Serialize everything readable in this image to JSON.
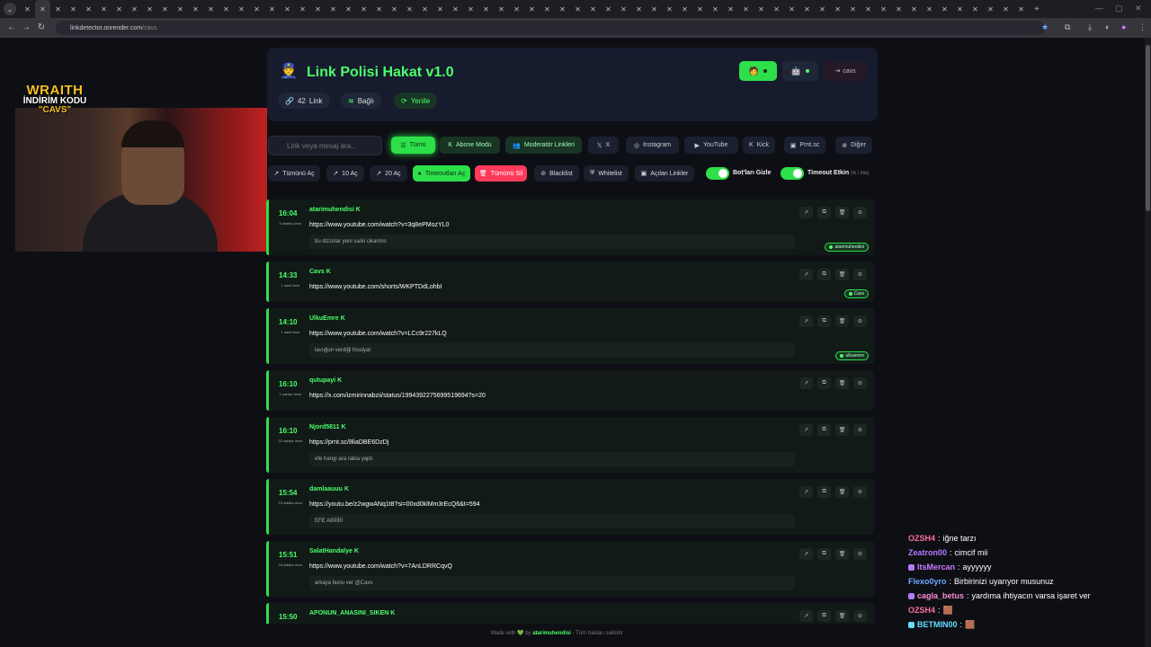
{
  "browser": {
    "url_host": "linkdetector.onrender.com",
    "url_path": "/cavs",
    "tab_count": 66
  },
  "overlay": {
    "line1": "WRAITH",
    "line2": "İNDİRİM KODU",
    "line3": "\"CAVS\""
  },
  "header": {
    "title": "Link Polisi Hakat v1.0",
    "link_count": "42",
    "link_label": "Link",
    "status": "Bağlı",
    "refresh": "Yenile",
    "logout": "cavs"
  },
  "search": {
    "placeholder": "Link veya mesaj ara..."
  },
  "filters": [
    "Tümü",
    "Abone Modu",
    "Moderatör Linkleri",
    "X",
    "Instagram",
    "YouTube",
    "Kick",
    "Prnt.sc",
    "Diğer"
  ],
  "actions": [
    "Tümünü Aç",
    "10 Aç",
    "20 Aç",
    "Timeoutları Aç",
    "Tümünü Sil",
    "Blacklist",
    "Whitelist",
    "Açılan Linkler"
  ],
  "toggles": {
    "hide_bots": "Bot'ları Gizle",
    "timeout": "Timeout Etkin",
    "timeout_sub": "(% / 24s)"
  },
  "links": [
    {
      "time": "16:04",
      "ago": "6 dakika önce",
      "user": "atarimuhendisi",
      "url": "https://www.youtube.com/watch?v=3q8ePMozYL0",
      "msg": "bu dizzolar yeni sarki cikarmis",
      "badge": "atarimuhendisi"
    },
    {
      "time": "14:33",
      "ago": "1 saat önce",
      "user": "Cavs",
      "url": "https://www.youtube.com/shorts/WKPTDdLohbI",
      "msg": "",
      "badge": "Cavs"
    },
    {
      "time": "14:10",
      "ago": "1 saat önce",
      "user": "UlkuEmre",
      "url": "https://www.youtube.com/watch?v=LCc9r227kLQ",
      "msg": "lavuğun verdiği hissiyat",
      "badge": "ulkuemre"
    },
    {
      "time": "16:10",
      "ago": "1 saniye önce",
      "user": "qutupayi",
      "url": "https://x.com/izmirinnabzii/status/1994392275699519694?s=20",
      "msg": "",
      "badge": ""
    },
    {
      "time": "16:10",
      "ago": "22 saniye önce",
      "user": "Njord5811",
      "url": "https://prnt.sc/8liaDBE6DzDj",
      "msg": "efe hangi ara rabia yaptı",
      "badge": ""
    },
    {
      "time": "15:54",
      "ago": "15 dakika önce",
      "user": "damlaauuu",
      "url": "https://youtu.be/z2wgwANq1t8?si=00xd0klMm3rEcQ6&t=594",
      "msg": "EFE ABİİİİİİ",
      "badge": ""
    },
    {
      "time": "15:51",
      "ago": "18 dakika önce",
      "user": "SalatHandalye",
      "url": "https://www.youtube.com/watch?v=7AnLDRRCqvQ",
      "msg": "arkaya bunu ver @Cavs",
      "badge": ""
    },
    {
      "time": "15:50",
      "ago": "",
      "user": "APONUN_ANASINI_SIKEN",
      "url": "",
      "msg": "",
      "badge": ""
    }
  ],
  "footer": {
    "pre": "Made with",
    "by": "by",
    "author": "atarimuhendisi",
    "post": "- Tüm hakları saklıdır"
  },
  "chat": [
    {
      "user": "OZSH4",
      "color": "#ff6e9c",
      "text": "iğne tarzı",
      "badge": ""
    },
    {
      "user": "Zeatron00",
      "color": "#b57aff",
      "text": "cimcif mii",
      "badge": ""
    },
    {
      "user": "ItsMercan",
      "color": "#c77dff",
      "text": "ayyyyyy",
      "badge": "#b57aff"
    },
    {
      "user": "Flexo0yro",
      "color": "#6ea8ff",
      "text": "Birbirinizi uyarıyor musunuz",
      "badge": ""
    },
    {
      "user": "cagla_betus",
      "color": "#ff8ad8",
      "text": "yardıma ihtiyacın varsa işaret ver",
      "badge": "#b57aff"
    },
    {
      "user": "OZSH4",
      "color": "#ff6e9c",
      "text": "🟫",
      "badge": ""
    },
    {
      "user": "BETMIN00",
      "color": "#5ee0ff",
      "text": "🟫",
      "badge": "#5ee0ff"
    }
  ]
}
